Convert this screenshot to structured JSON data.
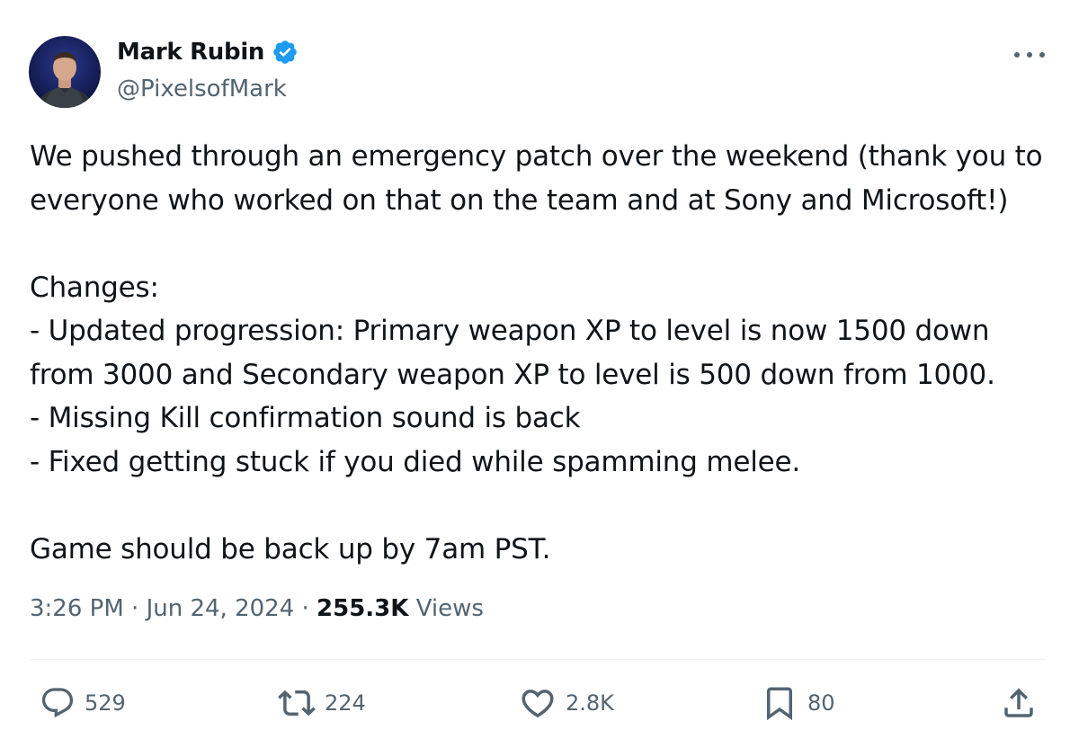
{
  "author": {
    "display_name": "Mark Rubin",
    "handle": "@PixelsofMark",
    "verified": true
  },
  "tweet": {
    "lines": [
      "We pushed through an emergency patch over the weekend (thank you to",
      "everyone who worked on that on the team and at Sony and Microsoft!)",
      "",
      "Changes:",
      "- Updated progression: Primary weapon XP to level is now 1500 down",
      "from 3000 and Secondary weapon XP to level is 500 down from 1000.",
      "- Missing Kill confirmation sound is back",
      "- Fixed getting stuck if you died while spamming melee.",
      "",
      "Game should be back up by 7am PST."
    ],
    "time": "3:26 PM",
    "date": "Jun 24, 2024",
    "separator": "·",
    "views_count": "255.3K",
    "views_label": "Views"
  },
  "actions": {
    "replies": "529",
    "reposts": "224",
    "likes": "2.8K",
    "bookmarks": "80"
  },
  "colors": {
    "verified_badge": "#1d9bf0",
    "secondary_text": "#536471",
    "primary_text": "#0f1419",
    "divider": "#eff3f4"
  },
  "icons": [
    "verified-badge-icon",
    "more-options-icon",
    "reply-icon",
    "repost-icon",
    "like-icon",
    "bookmark-icon",
    "share-icon"
  ]
}
